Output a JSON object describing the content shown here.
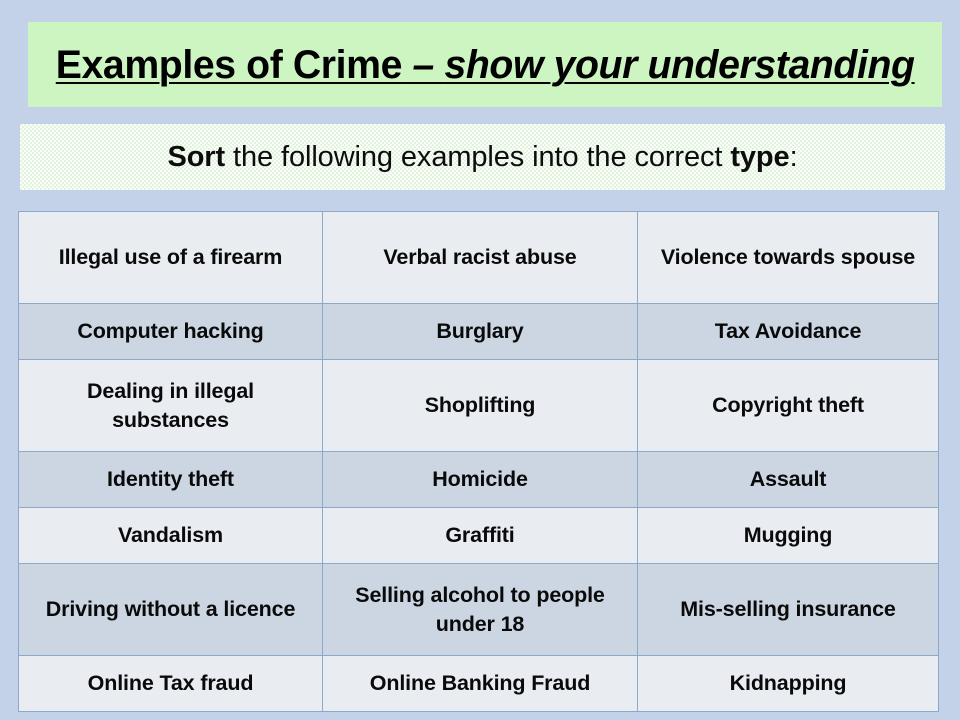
{
  "slide": {
    "background_color": "#c3d2e8",
    "title": {
      "banner_color": "#ccf5c2",
      "main": "Examples of Crime",
      "separator": " – ",
      "emphasis": "show your understanding"
    },
    "subtitle": {
      "banner_color": "#e2f4dd",
      "lead": "Sort",
      "middle": " the following examples into the correct ",
      "trailing": "type",
      "colon": ":"
    }
  },
  "table": {
    "border_color": "#8da9c9",
    "row_light_color": "#e9edf2",
    "row_dark_color": "#ccd6e3",
    "columns": 3,
    "rows": [
      {
        "shade": "light",
        "height": "tall",
        "cells": [
          "Illegal use of a firearm",
          "Verbal racist abuse",
          "Violence towards spouse"
        ]
      },
      {
        "shade": "dark",
        "height": "short",
        "cells": [
          "Computer  hacking",
          "Burglary",
          "Tax Avoidance"
        ]
      },
      {
        "shade": "light",
        "height": "tall",
        "cells": [
          "Dealing in illegal substances",
          "Shoplifting",
          "Copyright theft"
        ]
      },
      {
        "shade": "dark",
        "height": "short",
        "cells": [
          "Identity theft",
          "Homicide",
          "Assault"
        ]
      },
      {
        "shade": "light",
        "height": "short",
        "cells": [
          "Vandalism",
          "Graffiti",
          "Mugging"
        ]
      },
      {
        "shade": "dark",
        "height": "tall",
        "cells": [
          "Driving without a licence",
          "Selling alcohol to people under 18",
          "Mis-selling insurance"
        ]
      },
      {
        "shade": "light",
        "height": "short",
        "cells": [
          "Online Tax fraud",
          "Online Banking Fraud",
          "Kidnapping"
        ]
      }
    ]
  }
}
